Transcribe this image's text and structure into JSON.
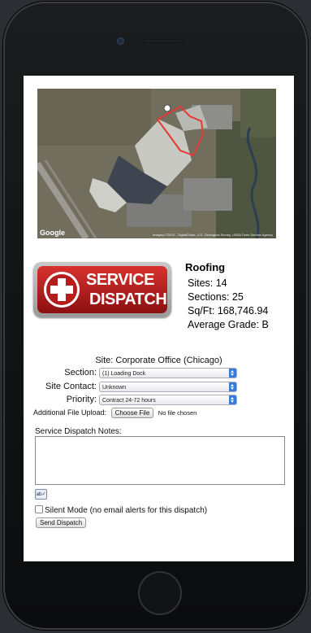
{
  "map": {
    "credit": "Imagery ©2015 , DigitalGlobe, U.S. Geological Survey, USDA Farm Service Agency",
    "logo": "Google",
    "marker": "1"
  },
  "logo": {
    "line1": "SERVICE",
    "line2": "DISPATCH"
  },
  "stats": {
    "title": "Roofing",
    "sites": "Sites: 14",
    "sections": "Sections: 25",
    "sqft": "Sq/Ft: 168,746.94",
    "grade": "Average Grade: B"
  },
  "form": {
    "site": "Site: Corporate Office (Chicago)",
    "section_label": "Section:",
    "section_value": "(1) Loading Dock",
    "contact_label": "Site Contact:",
    "contact_value": "Unknown",
    "priority_label": "Priority:",
    "priority_value": "Contract 24-72 hours",
    "file_label": "Additional File Upload:",
    "file_button": "Choose File",
    "file_status": "No file chosen",
    "notes_label": "Service Dispatch Notes:",
    "spell_label": "ab✓",
    "silent_label": "Silent Mode (no email alerts for this dispatch)",
    "send_button": "Send Dispatch"
  },
  "colors": {
    "accent_red": "#c62828",
    "select_arrow": "#3a7bd5"
  }
}
